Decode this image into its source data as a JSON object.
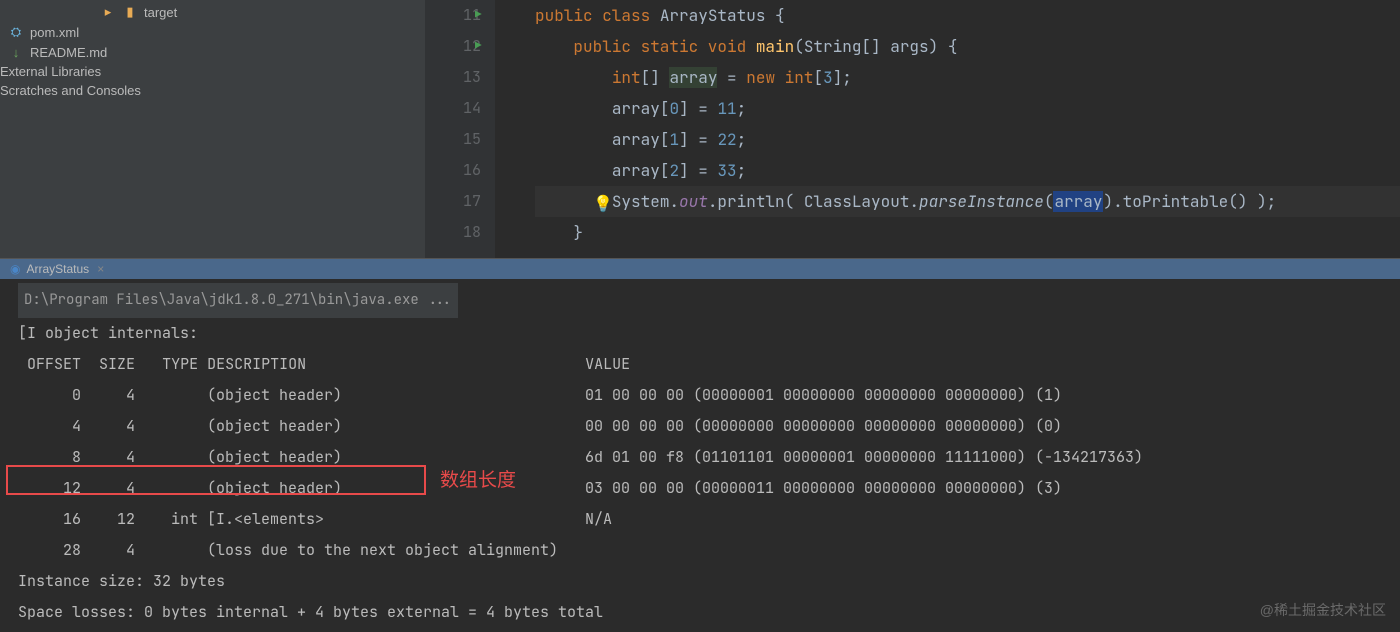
{
  "sidebar": {
    "items": [
      {
        "label": "target",
        "icon": "folder"
      },
      {
        "label": "pom.xml",
        "icon": "xml"
      },
      {
        "label": "README.md",
        "icon": "md"
      },
      {
        "label": "External Libraries",
        "icon": "lib"
      },
      {
        "label": "Scratches and Consoles",
        "icon": "scratch"
      }
    ]
  },
  "editor": {
    "line_start": 11,
    "lines": [
      {
        "n": "11",
        "run": true
      },
      {
        "n": "12",
        "run": true
      },
      {
        "n": "13"
      },
      {
        "n": "14"
      },
      {
        "n": "15"
      },
      {
        "n": "16"
      },
      {
        "n": "17",
        "bulb": true
      },
      {
        "n": "18"
      }
    ],
    "code": {
      "class_def": {
        "kw1": "public class",
        "name": "ArrayStatus",
        "brace": " {"
      },
      "main_def": {
        "kw1": "public static void",
        "name": "main",
        "params": "(String[] args) {"
      },
      "array_decl": {
        "kw1": "int",
        "arr": "[] ",
        "var": "array",
        "eq": " = ",
        "kw2": "new int",
        "br": "[",
        "num": "3",
        "end": "];"
      },
      "assign0": {
        "var": "array",
        "br": "[",
        "idx": "0",
        "mid": "] = ",
        "val": "11",
        "end": ";"
      },
      "assign1": {
        "var": "array",
        "br": "[",
        "idx": "1",
        "mid": "] = ",
        "val": "22",
        "end": ";"
      },
      "assign2": {
        "var": "array",
        "br": "[",
        "idx": "2",
        "mid": "] = ",
        "val": "33",
        "end": ";"
      },
      "print": {
        "sys": "System.",
        "out": "out",
        "dot": ".println( ClassLayout.",
        "parse": "parseInstance",
        "open": "(",
        "arg": "array",
        "close": ").toPrintable() );"
      },
      "close": "}"
    }
  },
  "run": {
    "tab": "ArrayStatus",
    "exec": "D:\\Program Files\\Java\\jdk1.8.0_271\\bin\\java.exe ...",
    "lines": {
      "header": "[I object internals:",
      "cols": {
        "off": "OFFSET",
        "size": "SIZE",
        "type": "TYPE",
        "desc": "DESCRIPTION",
        "val": "VALUE"
      },
      "rows": [
        {
          "off": "0",
          "size": "4",
          "type": "",
          "desc": "(object header)",
          "val": "01 00 00 00 (00000001 00000000 00000000 00000000) (1)"
        },
        {
          "off": "4",
          "size": "4",
          "type": "",
          "desc": "(object header)",
          "val": "00 00 00 00 (00000000 00000000 00000000 00000000) (0)"
        },
        {
          "off": "8",
          "size": "4",
          "type": "",
          "desc": "(object header)",
          "val": "6d 01 00 f8 (01101101 00000001 00000000 11111000) (-134217363)"
        },
        {
          "off": "12",
          "size": "4",
          "type": "",
          "desc": "(object header)",
          "val": "03 00 00 00 (00000011 00000000 00000000 00000000) (3)"
        },
        {
          "off": "16",
          "size": "12",
          "type": "int",
          "desc": "[I.<elements>",
          "val": "N/A"
        },
        {
          "off": "28",
          "size": "4",
          "type": "",
          "desc": "(loss due to the next object alignment)",
          "val": ""
        }
      ],
      "instance": "Instance size: 32 bytes",
      "losses": "Space losses: 0 bytes internal + 4 bytes external = 4 bytes total"
    },
    "annotation": "数组长度"
  },
  "watermark": "@稀土掘金技术社区"
}
